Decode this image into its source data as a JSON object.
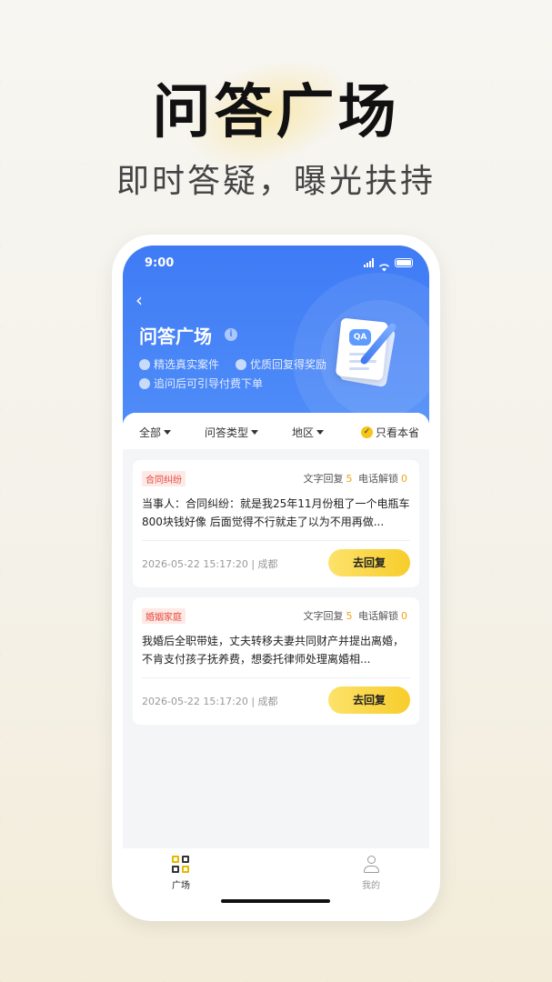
{
  "hero": {
    "title": "问答广场",
    "subtitle": "即时答疑，曝光扶持"
  },
  "status_bar": {
    "time": "9:00"
  },
  "header": {
    "back_icon": "chevron-left-icon",
    "title": "问答广场",
    "features": [
      "精选真实案件",
      "优质回复得奖励",
      "追问后可引导付费下单"
    ]
  },
  "filters": {
    "items": [
      "全部",
      "问答类型",
      "地区"
    ],
    "toggle_label": "只看本省",
    "toggle_checked": true
  },
  "cards": [
    {
      "tag": "合同纠纷",
      "stats_text_label": "文字回复",
      "stats_text_count": "5",
      "stats_phone_label": "电话解锁",
      "stats_phone_count": "0",
      "question": "当事人：合同纠纷：就是我25年11月份租了一个电瓶车 800块钱好像 后面觉得不行就走了以为不用再做...",
      "time": "2026-05-22 15:17:20",
      "location": "成都",
      "button": "去回复"
    },
    {
      "tag": "婚姻家庭",
      "stats_text_label": "文字回复",
      "stats_text_count": "5",
      "stats_phone_label": "电话解锁",
      "stats_phone_count": "0",
      "question": "我婚后全职带娃，丈夫转移夫妻共同财产并提出离婚，不肯支付孩子抚养费，想委托律师处理离婚相...",
      "time": "2026-05-22 15:17:20",
      "location": "成都",
      "button": "去回复"
    }
  ],
  "tabbar": {
    "items": [
      {
        "label": "广场",
        "icon": "square-grid-icon",
        "active": true
      },
      {
        "label": "我的",
        "icon": "person-icon",
        "active": false
      }
    ]
  },
  "colors": {
    "primary": "#3f7bf5",
    "accent": "#f7cd2b",
    "tag_red": "#e64a3c",
    "count_orange": "#f0a21b"
  }
}
